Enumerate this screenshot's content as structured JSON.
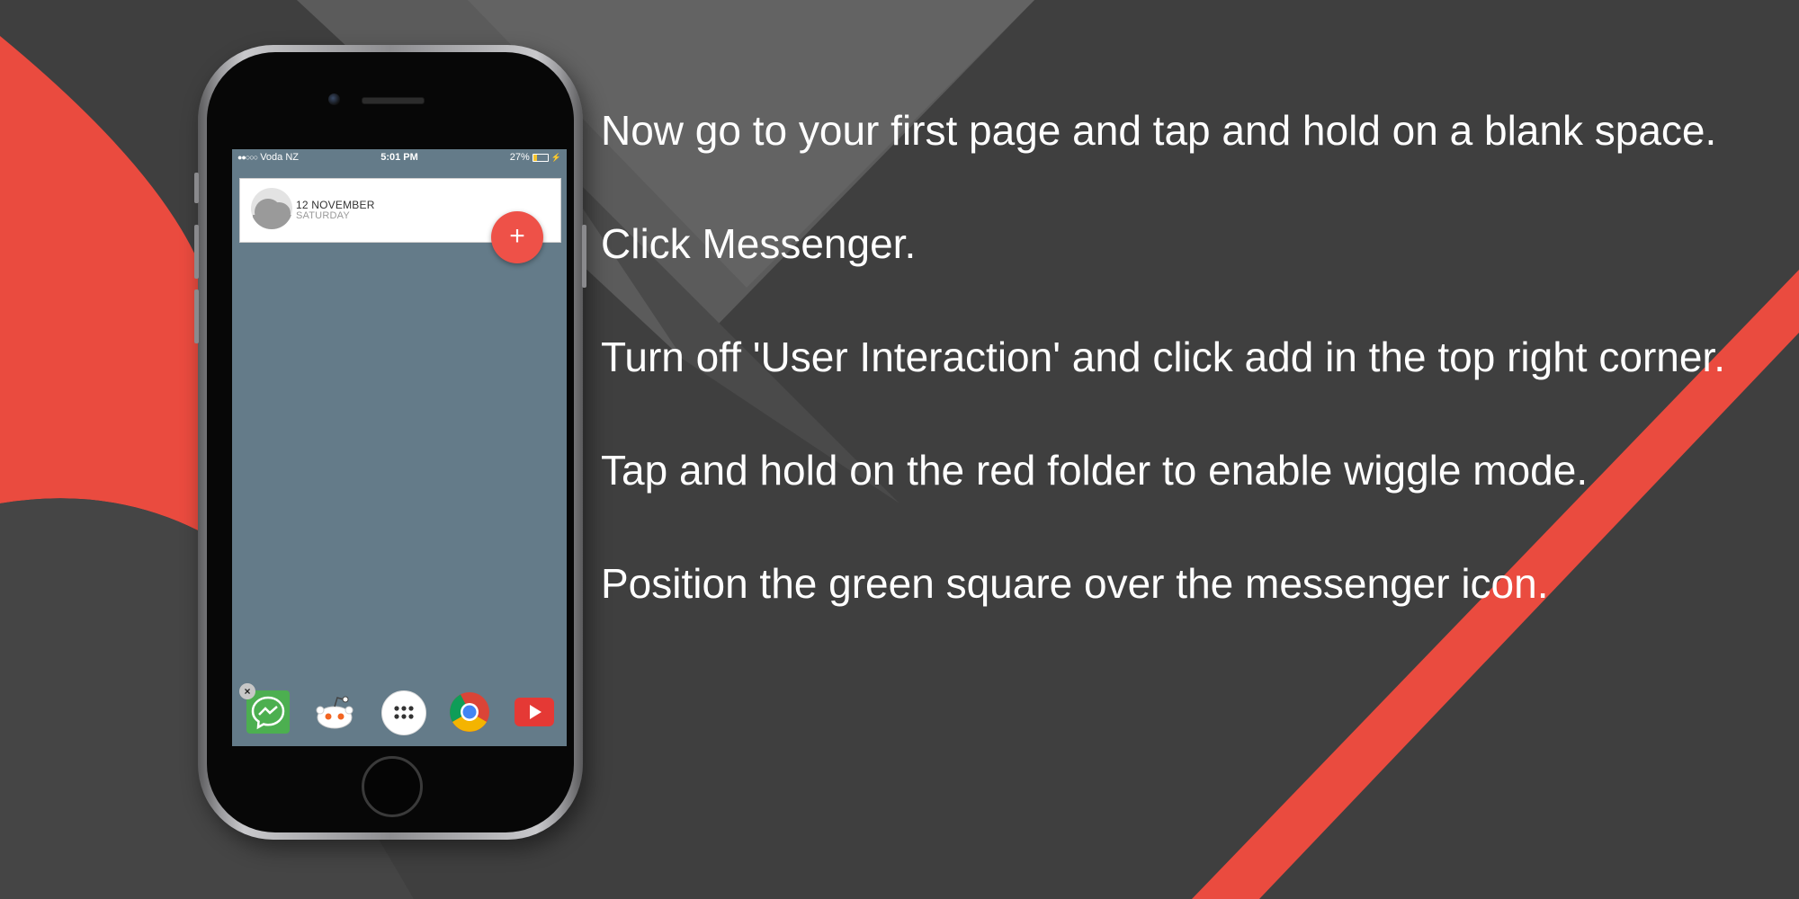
{
  "colors": {
    "accent_red": "#ea4b3f",
    "background_dark": "#3f3f3f",
    "screen_blue_gray": "#647b89",
    "messenger_green": "#4caf50"
  },
  "phone": {
    "status_bar": {
      "signal": "●●○○○",
      "carrier": "Voda NZ",
      "time": "5:01 PM",
      "battery_percent": "27%",
      "battery_level": 0.27
    },
    "date_widget": {
      "date": "12 NOVEMBER",
      "day": "SATURDAY",
      "add_button": "+"
    },
    "dock": {
      "delete_badge": "×",
      "icons": [
        "messenger-icon",
        "reddit-icon",
        "app-drawer-icon",
        "chrome-icon",
        "youtube-icon"
      ]
    }
  },
  "instructions": [
    "Now go to your first page and tap and hold on a blank space.",
    "Click Messenger.",
    "Turn off 'User Interaction' and click add in the top right corner.",
    "Tap and hold on the red folder to enable wiggle mode.",
    "Position the green square over the messenger icon."
  ]
}
